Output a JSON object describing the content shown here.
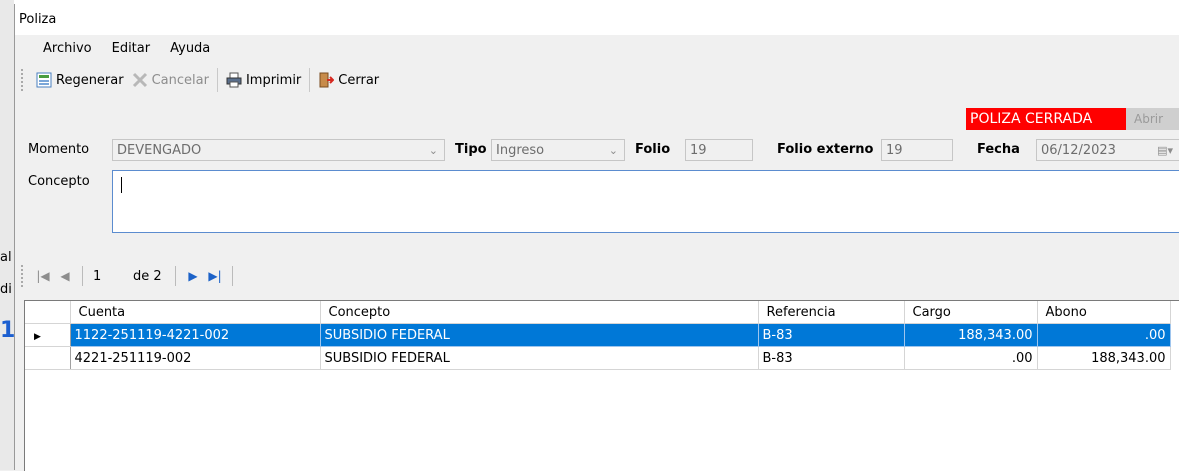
{
  "window": {
    "title": "Poliza"
  },
  "menu": [
    "Archivo",
    "Editar",
    "Ayuda"
  ],
  "toolbar": {
    "regenerar": "Regenerar",
    "cancelar": "Cancelar",
    "imprimir": "Imprimir",
    "cerrar": "Cerrar"
  },
  "status": {
    "label": "POLIZA CERRADA",
    "abrir": "Abrir"
  },
  "form": {
    "momento_label": "Momento",
    "momento_value": "DEVENGADO",
    "tipo_label": "Tipo",
    "tipo_value": "Ingreso",
    "folio_label": "Folio",
    "folio_value": "19",
    "folio_externo_label": "Folio externo",
    "folio_externo_value": "19",
    "fecha_label": "Fecha",
    "fecha_value": "06/12/2023",
    "concepto_label": "Concepto",
    "concepto_value": ""
  },
  "navigator": {
    "position": "1",
    "count": "de 2"
  },
  "grid": {
    "columns": [
      "Cuenta",
      "Concepto",
      "Referencia",
      "Cargo",
      "Abono"
    ],
    "rows": [
      {
        "cuenta": "1122-251119-4221-002",
        "concepto": "SUBSIDIO FEDERAL",
        "referencia": "B-83",
        "cargo": "188,343.00",
        "abono": ".00"
      },
      {
        "cuenta": "4221-251119-002",
        "concepto": "SUBSIDIO FEDERAL",
        "referencia": "B-83",
        "cargo": ".00",
        "abono": "188,343.00"
      }
    ]
  },
  "background": {
    "text1": "al",
    "text2": "di",
    "big": "1"
  },
  "colors": {
    "accent": "#0078d7",
    "status_red": "#ff0000"
  }
}
